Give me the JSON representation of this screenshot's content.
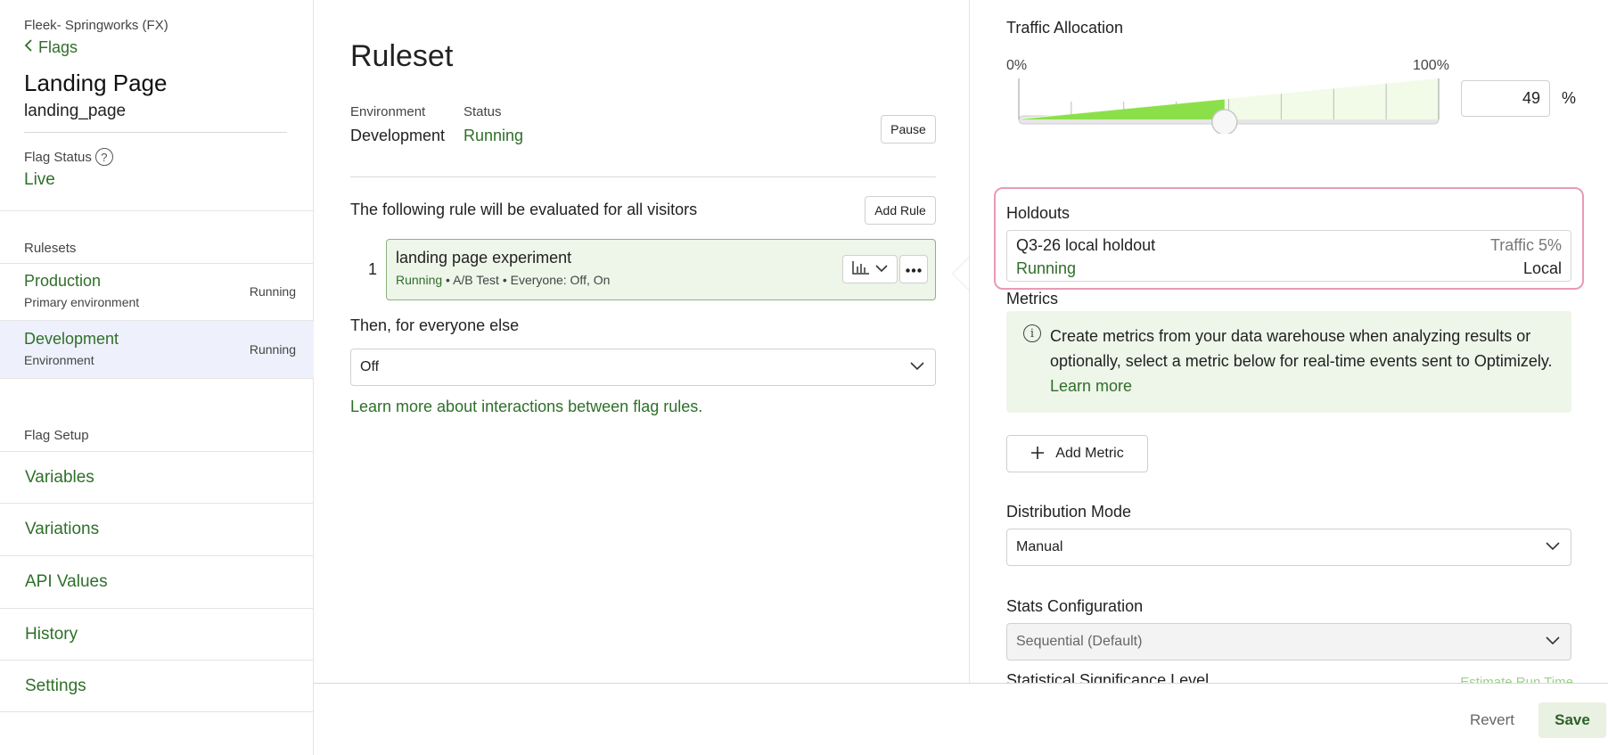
{
  "sidebar": {
    "project": "Fleek- Springworks (FX)",
    "back_label": "Flags",
    "flag_name": "Landing Page",
    "flag_key": "landing_page",
    "flag_status_label": "Flag Status",
    "flag_status_value": "Live",
    "rulesets_label": "Rulesets",
    "rulesets": [
      {
        "name": "Production",
        "sub": "Primary environment",
        "state": "Running"
      },
      {
        "name": "Development",
        "sub": "Environment",
        "state": "Running"
      }
    ],
    "flag_setup_label": "Flag Setup",
    "setup_items": [
      "Variables",
      "Variations",
      "API Values",
      "History",
      "Settings"
    ]
  },
  "ruleset": {
    "heading": "Ruleset",
    "environment_label": "Environment",
    "environment_value": "Development",
    "status_label": "Status",
    "status_value": "Running",
    "pause_label": "Pause",
    "rule_desc": "The following rule will be evaluated for all visitors",
    "add_rule_label": "Add Rule",
    "rule": {
      "number": "1",
      "name": "landing page experiment",
      "state": "Running",
      "meta": " • A/B Test • Everyone: Off, On"
    },
    "else_label": "Then, for everyone else",
    "else_value": "Off",
    "learn_link": "Learn more about interactions between flag rules."
  },
  "config": {
    "traffic_label": "Traffic Allocation",
    "range_min": "0%",
    "range_max": "100%",
    "traffic_value": "49",
    "traffic_fraction": 0.49,
    "pct_sign": "%",
    "holdouts_label": "Holdouts",
    "holdout": {
      "name": "Q3-26 local holdout",
      "traffic": "Traffic 5%",
      "state": "Running",
      "scope": "Local"
    },
    "metrics_label": "Metrics",
    "metrics_info": "Create metrics from your data warehouse when analyzing results or optionally, select a metric below for real-time events sent to Optimizely. ",
    "metrics_learn_more": "Learn more",
    "add_metric_label": "Add Metric",
    "distribution_label": "Distribution Mode",
    "distribution_value": "Manual",
    "stats_label": "Stats Configuration",
    "stats_value": "Sequential (Default)",
    "significance_label": "Statistical Significance Level",
    "estimate_link": "Estimate Run Time"
  },
  "footer": {
    "revert_label": "Revert",
    "save_label": "Save"
  },
  "colors": {
    "accent_green": "#2f6f2a",
    "highlight_pink": "#e89ab8",
    "slider_fill": "#8be04a"
  }
}
